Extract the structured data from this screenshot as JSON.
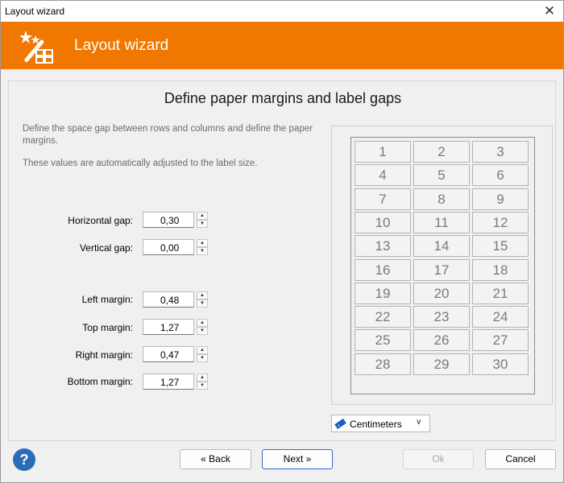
{
  "window": {
    "title": "Layout wizard",
    "close_symbol": "✕"
  },
  "header": {
    "title": "Layout wizard",
    "background": "#f07800",
    "icon": "magic-wand-label-icon"
  },
  "panel": {
    "title": "Define paper margins and label gaps",
    "description": "Define the space gap between rows and columns and define the paper margins.",
    "note": "These values are automatically adjusted to the label size."
  },
  "fields": {
    "horizontal_gap": {
      "label": "Horizontal gap:",
      "value": "0,30"
    },
    "vertical_gap": {
      "label": "Vertical gap:",
      "value": "0,00"
    },
    "left_margin": {
      "label": "Left margin:",
      "value": "0,48"
    },
    "top_margin": {
      "label": "Top margin:",
      "value": "1,27"
    },
    "right_margin": {
      "label": "Right margin:",
      "value": "0,47"
    },
    "bottom_margin": {
      "label": "Bottom margin:",
      "value": "1,27"
    }
  },
  "preview": {
    "columns": 3,
    "rows": 10,
    "labels": [
      "1",
      "2",
      "3",
      "4",
      "5",
      "6",
      "7",
      "8",
      "9",
      "10",
      "11",
      "12",
      "13",
      "14",
      "15",
      "16",
      "17",
      "18",
      "19",
      "20",
      "21",
      "22",
      "23",
      "24",
      "25",
      "26",
      "27",
      "28",
      "29",
      "30"
    ]
  },
  "units": {
    "selected": "Centimeters"
  },
  "buttons": {
    "back": "« Back",
    "next": "Next »",
    "ok": "Ok",
    "cancel": "Cancel"
  },
  "icons": {
    "help": "help-icon",
    "spin_up": "▲",
    "spin_down": "▼",
    "dropdown": "chevron-down-icon"
  },
  "colors": {
    "accent": "#f07800",
    "help": "#2b6cb8",
    "default_border": "#2a6ccc"
  }
}
